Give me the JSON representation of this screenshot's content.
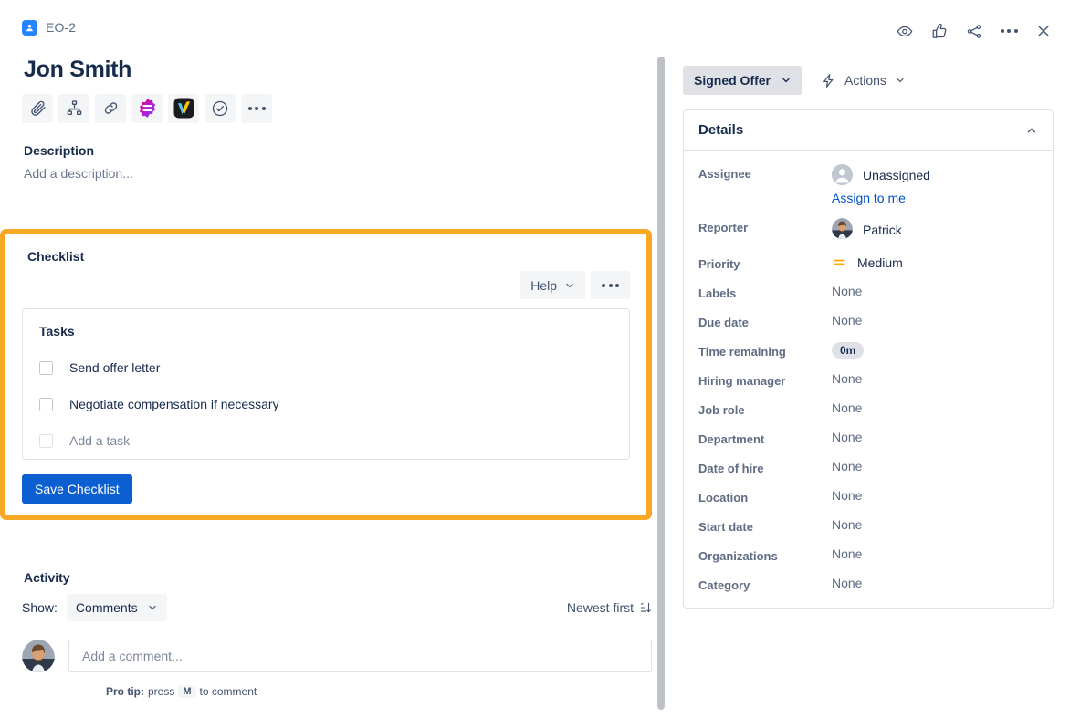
{
  "breadcrumb": {
    "icon": "person-badge-icon",
    "label": "EO-2"
  },
  "issue": {
    "title": "Jon Smith"
  },
  "toolbar": {
    "items": [
      {
        "name": "attach-icon",
        "label": "Attach"
      },
      {
        "name": "child-issue-icon",
        "label": "Add a child issue"
      },
      {
        "name": "link-icon",
        "label": "Link issue"
      },
      {
        "name": "app-badge-icon",
        "label": "App"
      },
      {
        "name": "app-check-icon",
        "label": "App"
      },
      {
        "name": "check-circle-icon",
        "label": "Checklist"
      },
      {
        "name": "more-icon",
        "label": "More"
      }
    ]
  },
  "description": {
    "heading": "Description",
    "placeholder": "Add a description..."
  },
  "checklist": {
    "heading": "Checklist",
    "help_label": "Help",
    "more_label": "...",
    "tasks_heading": "Tasks",
    "tasks": [
      {
        "label": "Send offer letter",
        "checked": false,
        "muted": false
      },
      {
        "label": "Negotiate compensation if necessary",
        "checked": false,
        "muted": false
      },
      {
        "label": "Add a task",
        "checked": false,
        "muted": true
      }
    ],
    "save_label": "Save Checklist",
    "highlight_color": "#F9A825"
  },
  "activity": {
    "heading": "Activity",
    "show_label": "Show:",
    "show_value": "Comments",
    "sort_label": "Newest first",
    "comment_placeholder": "Add a comment...",
    "protip_prefix": "Pro tip:",
    "protip_mid": "press",
    "protip_key": "M",
    "protip_suffix": "to comment"
  },
  "header_actions": [
    {
      "name": "watch-eye-icon",
      "label": "Watch"
    },
    {
      "name": "thumbs-up-icon",
      "label": "Like"
    },
    {
      "name": "share-icon",
      "label": "Share"
    },
    {
      "name": "more-icon",
      "label": "More actions"
    },
    {
      "name": "close-icon",
      "label": "Close"
    }
  ],
  "sidebar": {
    "status": "Signed Offer",
    "actions_label": "Actions",
    "details_heading": "Details",
    "assignee": {
      "key": "Assignee",
      "value": "Unassigned",
      "assign_to_me": "Assign to me"
    },
    "fields": [
      {
        "key": "Reporter",
        "value": "Patrick",
        "type": "avatar"
      },
      {
        "key": "Priority",
        "value": "Medium",
        "type": "priority"
      },
      {
        "key": "Labels",
        "value": "None",
        "type": "none"
      },
      {
        "key": "Due date",
        "value": "None",
        "type": "none"
      },
      {
        "key": "Time remaining",
        "value": "0m",
        "type": "pill"
      },
      {
        "key": "Hiring manager",
        "value": "None",
        "type": "none"
      },
      {
        "key": "Job role",
        "value": "None",
        "type": "none"
      },
      {
        "key": "Department",
        "value": "None",
        "type": "none"
      },
      {
        "key": "Date of hire",
        "value": "None",
        "type": "none"
      },
      {
        "key": "Location",
        "value": "None",
        "type": "none"
      },
      {
        "key": "Start date",
        "value": "None",
        "type": "none"
      },
      {
        "key": "Organizations",
        "value": "None",
        "type": "none"
      },
      {
        "key": "Category",
        "value": "None",
        "type": "none"
      }
    ],
    "accent_color": "#0052CC",
    "priority_color": "#FFAB00"
  }
}
